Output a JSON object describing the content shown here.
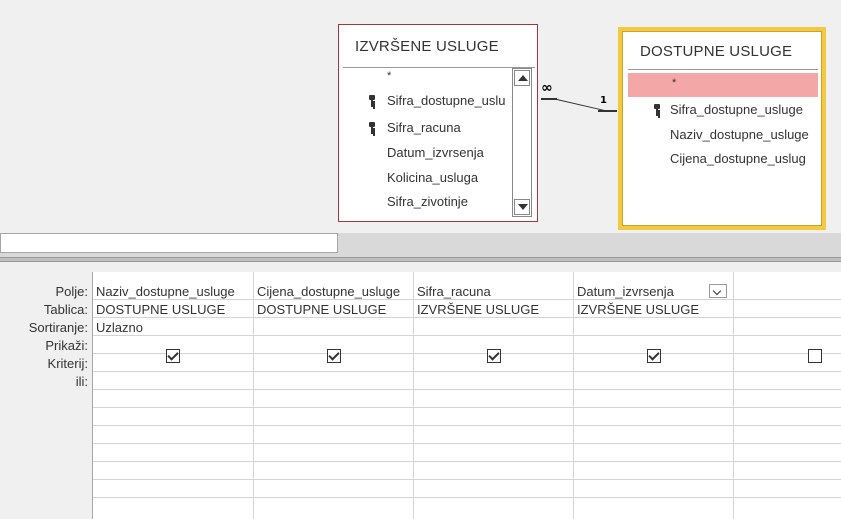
{
  "tables": [
    {
      "title": "IZVRŠENE USLUGE",
      "fields": [
        "*",
        "Sifra_dostupne_uslu",
        "Sifra_racuna",
        "Datum_izvrsenja",
        "Kolicina_usluga",
        "Sifra_zivotinje"
      ]
    },
    {
      "title": "DOSTUPNE USLUGE",
      "fields": [
        "*",
        "Sifra_dostupne_usluge",
        "Naziv_dostupne_usluge",
        "Cijena_dostupne_uslug"
      ]
    }
  ],
  "relationship": {
    "many": "∞",
    "one": "1"
  },
  "grid": {
    "row_labels": [
      "Polje:",
      "Tablica:",
      "Sortiranje:",
      "Prikaži:",
      "Kriterij:",
      "ili:"
    ],
    "columns": [
      {
        "field": "Naziv_dostupne_usluge",
        "table": "DOSTUPNE USLUGE",
        "sort": "Uzlazno",
        "show": true
      },
      {
        "field": "Cijena_dostupne_usluge",
        "table": "DOSTUPNE USLUGE",
        "sort": "",
        "show": true
      },
      {
        "field": "Sifra_racuna",
        "table": "IZVRŠENE USLUGE",
        "sort": "",
        "show": true
      },
      {
        "field": "Datum_izvrsenja",
        "table": "IZVRŠENE USLUGE",
        "sort": "",
        "show": true
      },
      {
        "field": "",
        "table": "",
        "sort": "",
        "show": false
      }
    ]
  },
  "colors": {
    "table1_border": "#a4373a",
    "table2_border": "#f5c842",
    "table2_highlight": "#f4a7a7"
  }
}
